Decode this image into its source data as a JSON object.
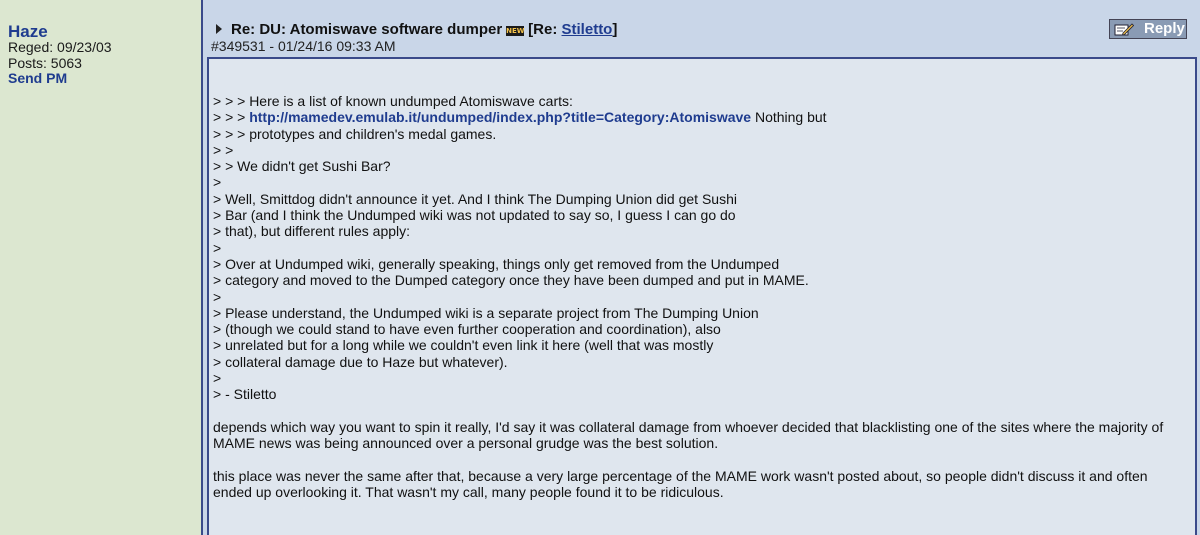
{
  "sidebar": {
    "username": "Haze",
    "reged": "Reged: 09/23/03",
    "posts": "Posts: 5063",
    "send_pm": "Send PM"
  },
  "header": {
    "subject_prefix": "Re: DU: Atomiswave software dumper",
    "new_badge": "NEW",
    "re_open": "[Re: ",
    "re_link": "Stiletto",
    "re_close": "]",
    "post_meta": "#349531 - 01/24/16 09:33 AM",
    "reply_label": "Reply",
    "icons": {
      "arrow": "triangle-right-icon",
      "new": "new-badge-icon",
      "reply": "pencil-paper-icon"
    }
  },
  "message": {
    "q1": "> > > Here is a list of known undumped Atomiswave carts:",
    "q2_prefix": "> > > ",
    "q2_link": "http://mamedev.emulab.it/undumped/index.php?title=Category:Atomiswave",
    "q2_suffix": " Nothing but",
    "q3": "> > > prototypes and children's medal games.",
    "q4": "> >",
    "q5": "> > We didn't get Sushi Bar?",
    "q6": ">",
    "q7": "> Well, Smittdog didn't announce it yet. And I think The Dumping Union did get Sushi",
    "q8": "> Bar (and I think the Undumped wiki was not updated to say so, I guess I can go do",
    "q9": "> that), but different rules apply:",
    "q10": ">",
    "q11": "> Over at Undumped wiki, generally speaking, things only get removed from the Undumped",
    "q12": "> category and moved to the Dumped category once they have been dumped and put in MAME.",
    "q13": ">",
    "q14": "> Please understand, the Undumped wiki is a separate project from The Dumping Union",
    "q15": "> (though we could stand to have even further cooperation and coordination), also",
    "q16": "> unrelated but for a long while we couldn't even link it here (well that was mostly",
    "q17": "> collateral damage due to Haze but whatever).",
    "q18": ">",
    "q19": "> - Stiletto",
    "p1": "depends which way you want to spin it really, I'd say it was collateral damage from whoever decided that blacklisting one of the sites where the majority of MAME news was being announced over a personal grudge was the best solution.",
    "p2": "this place was never the same after that, because a very large percentage of the MAME work wasn't posted about, so people didn't discuss it and often ended up overlooking it. That wasn't my call, many people found it to be ridiculous."
  },
  "colors": {
    "sidebar_bg": "#dce7d0",
    "header_bg": "#c9d6e8",
    "body_bg": "#dfe6ee",
    "link": "#1f3c8f",
    "border": "#3a4a8a",
    "reply_bg": "#8a9bb4"
  }
}
